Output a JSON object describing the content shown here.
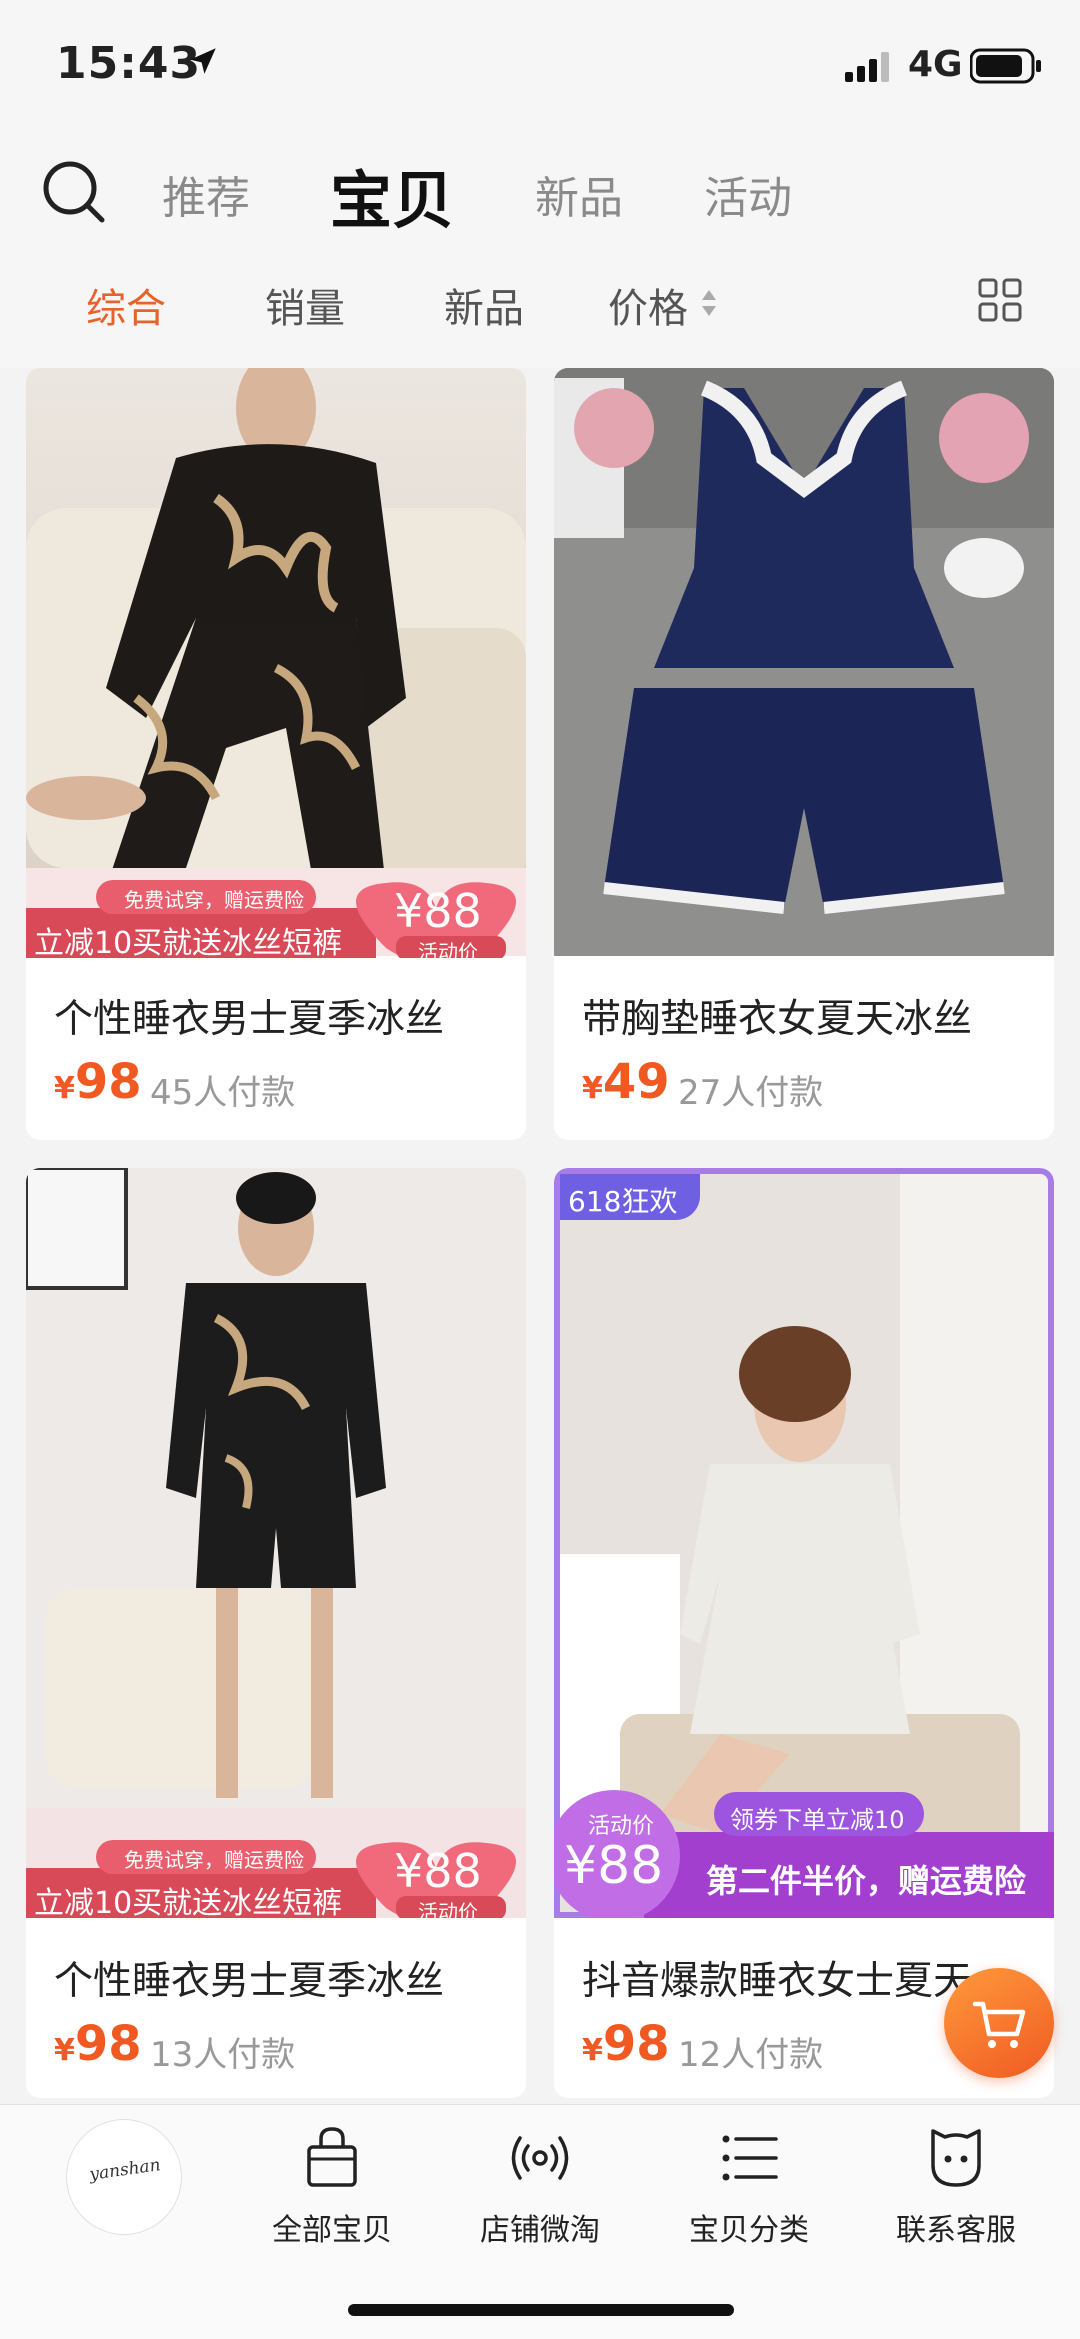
{
  "status": {
    "time": "15:43",
    "network": "4G"
  },
  "top_tabs": [
    "推荐",
    "宝贝",
    "新品",
    "活动"
  ],
  "sort_options": [
    "综合",
    "销量",
    "新品",
    "价格"
  ],
  "products": [
    {
      "title": "个性睡衣男士夏季冰丝",
      "price": "98",
      "buyers": "45人付款",
      "promo": {
        "line1": "免费试穿，赠运费险",
        "line2": "立减10买就送冰丝短裤",
        "price": "¥88",
        "tag": "活动价"
      }
    },
    {
      "title": "带胸垫睡衣女夏天冰丝",
      "price": "49",
      "buyers": "27人付款"
    },
    {
      "title": "个性睡衣男士夏季冰丝",
      "price": "98",
      "buyers": "13人付款",
      "promo": {
        "line1": "免费试穿，赠运费险",
        "line2": "立减10买就送冰丝短裤",
        "price": "¥88",
        "tag": "活动价"
      }
    },
    {
      "title": "抖音爆款睡衣女士夏天",
      "price": "98",
      "buyers": "12人付款",
      "badge": "618狂欢",
      "promo": {
        "tag": "活动价",
        "price": "¥88",
        "coupon": "领券下单立减10",
        "line2": "第二件半价，赠运费险"
      }
    }
  ],
  "currency_symbol": "¥",
  "bottom_nav": {
    "logo_text": "yanshan",
    "items": [
      {
        "label": "全部宝贝",
        "icon": "shopping-bag-icon"
      },
      {
        "label": "店铺微淘",
        "icon": "broadcast-icon"
      },
      {
        "label": "宝贝分类",
        "icon": "list-icon"
      },
      {
        "label": "联系客服",
        "icon": "chat-face-icon"
      }
    ]
  },
  "colors": {
    "accent": "#f05a22",
    "tab_active": "#e8622c",
    "card_bg": "#ffffff",
    "page_bg": "#f3f3f3"
  }
}
